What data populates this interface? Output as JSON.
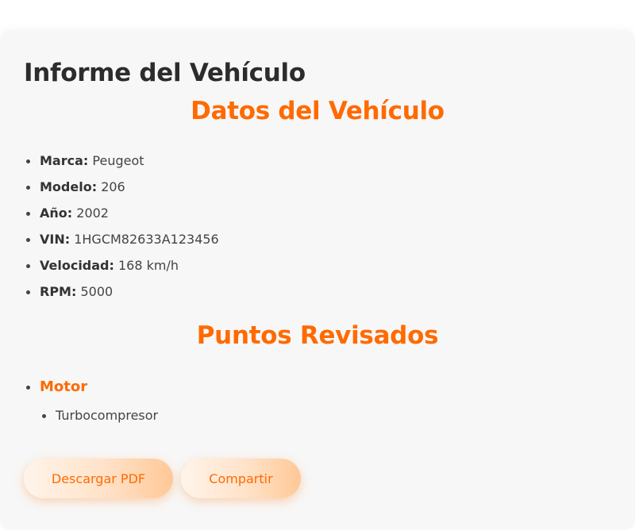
{
  "report": {
    "title": "Informe del Vehículo",
    "vehicle_section_title": "Datos del Vehículo",
    "checked_section_title": "Puntos Revisados"
  },
  "vehicle": [
    {
      "label": "Marca:",
      "value": "Peugeot"
    },
    {
      "label": "Modelo:",
      "value": "206"
    },
    {
      "label": "Año:",
      "value": "2002"
    },
    {
      "label": "VIN:",
      "value": "1HGCM82633A123456"
    },
    {
      "label": "Velocidad:",
      "value": "168 km/h"
    },
    {
      "label": "RPM:",
      "value": "5000"
    }
  ],
  "checked_points": [
    {
      "name": "Motor",
      "items": [
        "Turbocompresor"
      ]
    }
  ],
  "actions": {
    "download_label": "Descargar PDF",
    "share_label": "Compartir"
  },
  "colors": {
    "accent": "#ff6a00",
    "background": "#f7f7f7",
    "text": "#333333"
  }
}
